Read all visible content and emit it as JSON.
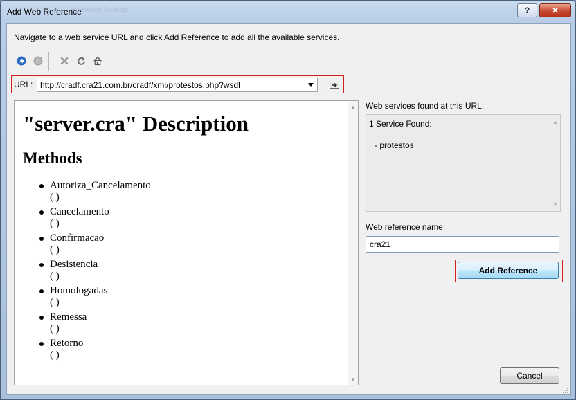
{
  "window": {
    "title": "Add Web Reference",
    "background_title": "Reference Settings",
    "help_label": "?",
    "close_label": "✕"
  },
  "instructions": "Navigate to a web service URL and click Add Reference to add all the available services.",
  "toolbar": {
    "icons": [
      "back-icon",
      "forward-icon",
      "stop-icon",
      "refresh-icon",
      "home-icon"
    ]
  },
  "url": {
    "label": "URL:",
    "value": "http://cradf.cra21.com.br/cradf/xml/protestos.php?wsdl"
  },
  "document": {
    "title": "\"server.cra\" Description",
    "methods_heading": "Methods",
    "methods": [
      "Autoriza_Cancelamento ( )",
      "Cancelamento ( )",
      "Confirmacao ( )",
      "Desistencia ( )",
      "Homologadas ( )",
      "Remessa ( )",
      "Retorno ( )"
    ]
  },
  "services": {
    "label": "Web services found at this URL:",
    "count_text": "1 Service Found:",
    "items": [
      "- protestos"
    ]
  },
  "reference": {
    "label": "Web reference name:",
    "value": "cra21"
  },
  "buttons": {
    "add": "Add Reference",
    "cancel": "Cancel"
  },
  "colors": {
    "highlight_border": "#d02020",
    "accent_blue": "#2a6cc0"
  }
}
